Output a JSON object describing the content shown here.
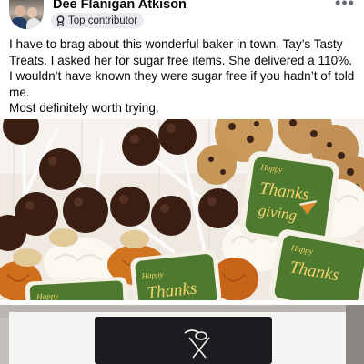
{
  "post": {
    "author_name": "Dee Flanigan Atkison",
    "badge_label": "Top contributor",
    "badge_icon": "ribbon-icon",
    "more_icon": "more-options-icon",
    "text_lines": [
      "I have to brag about this wonderful baker in town, Tay’s Tasty Treats. I asked her for sugar free items. She delivered a 110%. I wouldn’t have known they were sugar free if you hadn’t of told me.",
      "Most definitely worth trying."
    ]
  },
  "photo": {
    "cookie_text_1a": "Happy",
    "cookie_text_1b": "Thanks",
    "cookie_text_1c": "giving",
    "cookie_text_2a": "Happy",
    "cookie_text_2b": "Thanks",
    "cookie_text_3a": "Happy",
    "cookie_text_3b": "Thanks",
    "cookie_text_4": "Happy"
  },
  "colors": {
    "badge_bg": "#e9ebee",
    "cookie_green": "#4e7a2f",
    "cookie_orange": "#d0741e",
    "cake_pop_brown": "#3a1e12"
  }
}
